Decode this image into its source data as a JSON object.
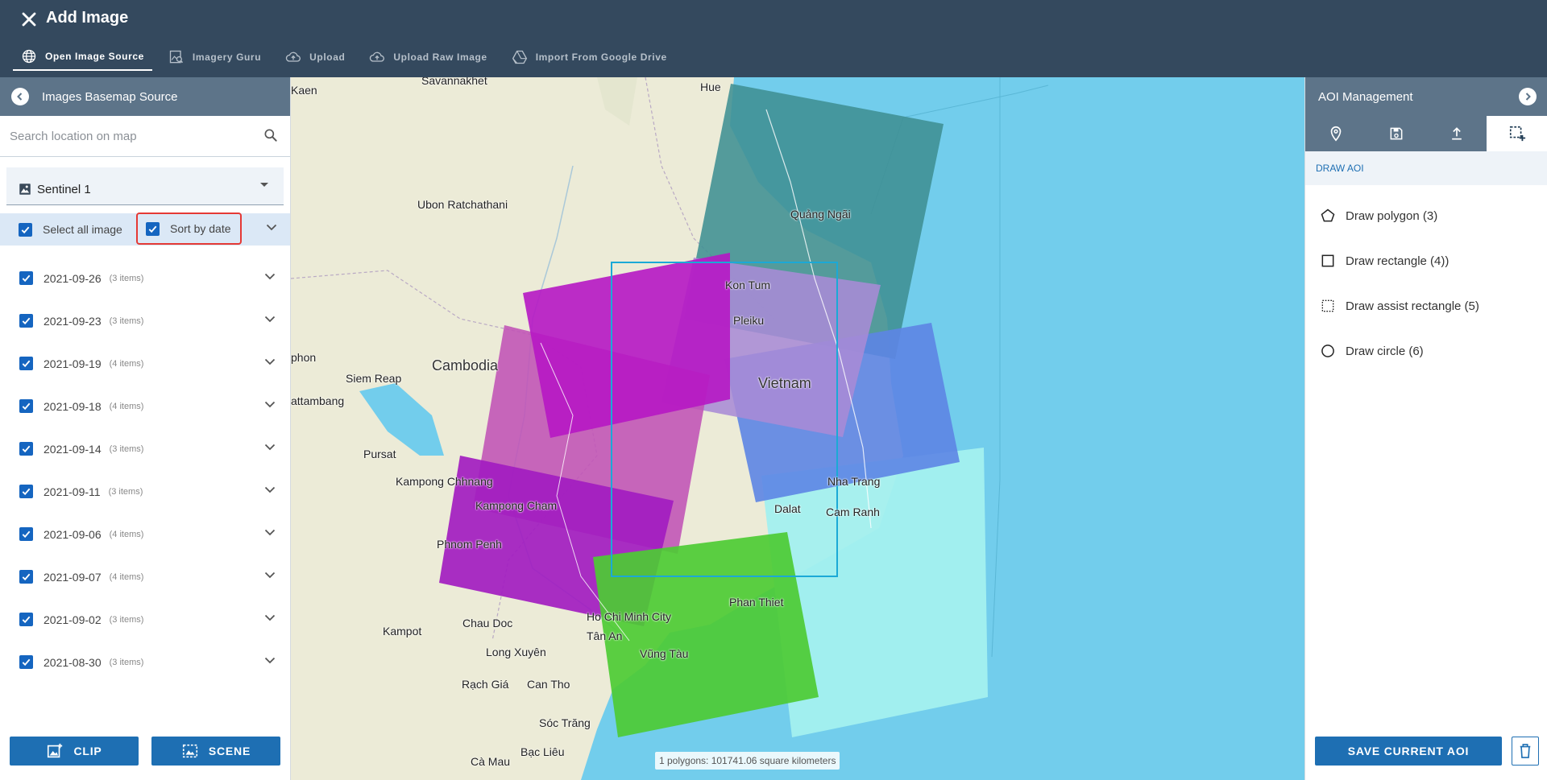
{
  "header": {
    "title": "Add Image",
    "tabs": [
      {
        "label": "Open Image Source",
        "icon": "globe-icon",
        "active": true
      },
      {
        "label": "Imagery Guru",
        "icon": "image-search-icon",
        "active": false
      },
      {
        "label": "Upload",
        "icon": "cloud-upload-icon",
        "active": false
      },
      {
        "label": "Upload Raw Image",
        "icon": "cloud-upload-icon",
        "active": false
      },
      {
        "label": "Import From Google Drive",
        "icon": "google-drive-icon",
        "active": false
      }
    ]
  },
  "left_panel": {
    "title": "Images Basemap Source",
    "search_placeholder": "Search location on map",
    "source": "Sentinel 1",
    "select_all_label": "Select all image",
    "select_all_checked": true,
    "sort_by_date_label": "Sort by date",
    "sort_by_date_checked": true,
    "dates": [
      {
        "date": "2021-09-26",
        "count": "(3 items)",
        "checked": true
      },
      {
        "date": "2021-09-23",
        "count": "(3 items)",
        "checked": true
      },
      {
        "date": "2021-09-19",
        "count": "(4 items)",
        "checked": true
      },
      {
        "date": "2021-09-18",
        "count": "(4 items)",
        "checked": true
      },
      {
        "date": "2021-09-14",
        "count": "(3 items)",
        "checked": true
      },
      {
        "date": "2021-09-11",
        "count": "(3 items)",
        "checked": true
      },
      {
        "date": "2021-09-06",
        "count": "(4 items)",
        "checked": true
      },
      {
        "date": "2021-09-07",
        "count": "(4 items)",
        "checked": true
      },
      {
        "date": "2021-09-02",
        "count": "(3 items)",
        "checked": true
      },
      {
        "date": "2021-08-30",
        "count": "(3 items)",
        "checked": true
      }
    ],
    "clip_label": "CLIP",
    "scene_label": "SCENE"
  },
  "map": {
    "labels": {
      "savannakhet": "Savannakhet",
      "hue": "Hue",
      "kaen": "Kaen",
      "ubon": "Ubon Ratchathani",
      "quang_ngai": "Quảng Ngãi",
      "kon_tum": "Kon Tum",
      "pleiku": "Pleiku",
      "cambodia": "Cambodia",
      "phon": "phon",
      "siem_reap": "Siem Reap",
      "vietnam": "Vietnam",
      "battambang": "attambang",
      "pursat": "Pursat",
      "kampong_chhnang": "Kampong Chhnang",
      "nha_trang": "Nha Trang",
      "kampong_cham": "Kampong Cham",
      "dalat": "Dalat",
      "cam_ranh": "Cam Ranh",
      "phnom_penh": "Phnom Penh",
      "phan_thiet": "Phan Thiet",
      "kampot": "Kampot",
      "chau_doc": "Chau Doc",
      "hcmc": "Ho Chi Minh City",
      "tan_an": "Tân An",
      "long_xuyen": "Long Xuyên",
      "vung_tau": "Vũng Tàu",
      "rach_gia": "Rạch Giá",
      "can_tho": "Can Tho",
      "soc_trang": "Sóc Trăng",
      "ca_mau": "Cà Mau",
      "bac_lieu": "Bạc Liêu"
    },
    "footprint_colors": {
      "teal": "#3f8f93",
      "magenta": "#b617c4",
      "pink": "#c052b6",
      "lavender": "#a98bd6",
      "blue": "#5d85e4",
      "cyan": "#a3f0ef",
      "green": "#4dcb34",
      "aoi_outline": "#1ba9d6"
    },
    "scale_readout": "1 polygons: 101741.06 square kilometers"
  },
  "right_panel": {
    "title": "AOI Management",
    "tabs": [
      {
        "icon": "location-pin-icon",
        "active": false
      },
      {
        "icon": "save-icon",
        "active": false
      },
      {
        "icon": "upload-icon",
        "active": false
      },
      {
        "icon": "draw-area-icon",
        "active": true
      }
    ],
    "section_label": "DRAW AOI",
    "tools": [
      {
        "label": "Draw polygon (3)",
        "icon": "polygon-icon"
      },
      {
        "label": "Draw rectangle (4))",
        "icon": "rectangle-icon"
      },
      {
        "label": "Draw assist rectangle (5)",
        "icon": "dashed-rectangle-icon"
      },
      {
        "label": "Draw circle (6)",
        "icon": "circle-icon"
      }
    ],
    "save_label": "SAVE CURRENT AOI"
  }
}
